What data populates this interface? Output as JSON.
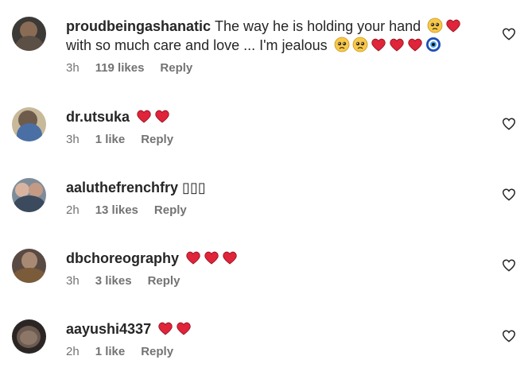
{
  "comments": [
    {
      "username": "proudbeingashanatic",
      "text_part1": "The way he is holding your hand",
      "text_part2": "with so much care and love ... I'm jealous",
      "time": "3h",
      "likes": "119 likes",
      "reply": "Reply",
      "avatar_colors": [
        "#3b3a36",
        "#8a6b55"
      ],
      "emoji_after_part1": [
        "pleading-face",
        "red-heart"
      ],
      "emoji_after_part2": [
        "pleading-face",
        "pleading-face",
        "red-heart",
        "red-heart",
        "red-heart",
        "nazar-amulet"
      ]
    },
    {
      "username": "dr.utsuka",
      "text": "",
      "time": "3h",
      "likes": "1 like",
      "reply": "Reply",
      "avatar_colors": [
        "#c7b99a",
        "#4a6fa5"
      ],
      "emoji": [
        "red-heart",
        "red-heart"
      ]
    },
    {
      "username": "aaluthefrenchfry",
      "text": "▯▯▯",
      "time": "2h",
      "likes": "13 likes",
      "reply": "Reply",
      "avatar_colors": [
        "#7e8c9a",
        "#d8b4a0"
      ],
      "emoji": []
    },
    {
      "username": "dbchoreography",
      "text": "",
      "time": "3h",
      "likes": "3 likes",
      "reply": "Reply",
      "avatar_colors": [
        "#5a4a44",
        "#a88a74"
      ],
      "emoji": [
        "red-heart",
        "red-heart",
        "red-heart"
      ]
    },
    {
      "username": "aayushi4337",
      "text": "",
      "time": "2h",
      "likes": "1 like",
      "reply": "Reply",
      "avatar_colors": [
        "#2b2624",
        "#6b5a50"
      ],
      "emoji": [
        "red-heart",
        "red-heart"
      ]
    }
  ],
  "colors": {
    "text": "#262626",
    "meta": "#737373",
    "heart": "#e0243a",
    "like_outline": "#262626"
  }
}
